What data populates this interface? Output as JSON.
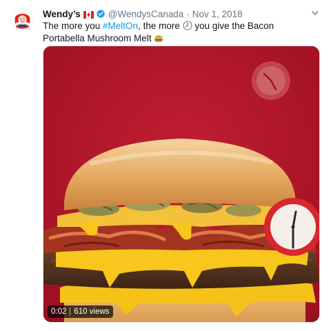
{
  "tweet": {
    "author_name": "Wendy’s",
    "handle": "@WendysCanada",
    "separator": "·",
    "date": "Nov 1, 2018",
    "text_before": "The more you ",
    "hashtag": "#MeltOn",
    "text_middle": ", the more ",
    "text_after": " you give the Bacon Portabella Mushroom Melt ",
    "icons": {
      "avatar": "wendys-logo-icon",
      "flag": "canada-flag-icon",
      "verified": "verified-badge-icon",
      "menu": "chevron-down-icon",
      "clock_emoji": "clock-emoji-icon",
      "burger_emoji": "burger-emoji-icon"
    }
  },
  "video": {
    "timestamp": "0:02",
    "views": "610 views"
  },
  "colors": {
    "hashtag": "#1b95e0",
    "verified": "#1da1f2",
    "muted": "#657786",
    "video_bg": "#b0162a"
  }
}
